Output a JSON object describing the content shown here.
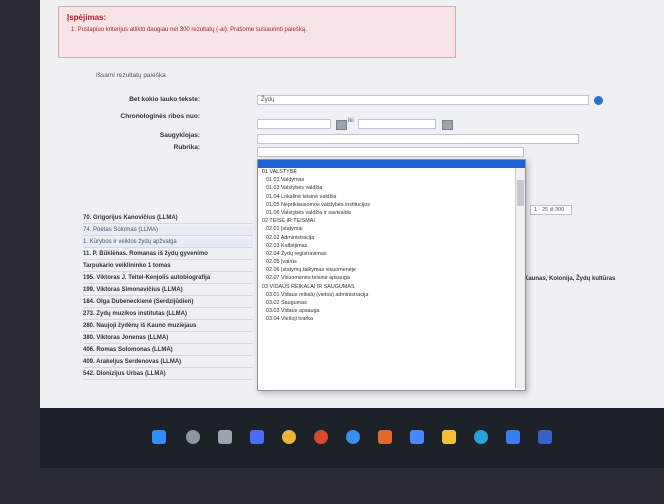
{
  "alert": {
    "title": "Įspėjimas:",
    "message": "1. Puslapiuo kriterijus atlikto daugiau nei 300 rezultatų (-ai). Prašome susiaurinti paiešką."
  },
  "form": {
    "section_title": "Išsami rezultatų paieška",
    "any_field_label": "Bet kokio lauko tekste:",
    "any_field_value": "Žydų",
    "date_label": "Chronologinės ribos nuo:",
    "date_to_label": "iki",
    "collection_label": "Saugyklojas:",
    "rubric_label": "Rubrika:"
  },
  "dropdown_options": [
    {
      "text": "01 VALSTYBĖ",
      "sub": false
    },
    {
      "text": "01.01 Valdymas",
      "sub": true
    },
    {
      "text": "01.03 Valstybės valdžia",
      "sub": true
    },
    {
      "text": "01.04 Lokalinė teisinė valdžia",
      "sub": true
    },
    {
      "text": "01.05 Nepriklausomos valstybės institucijos",
      "sub": true
    },
    {
      "text": "01.06 Valstybės valdžia ir savivalda",
      "sub": true
    },
    {
      "text": "02 TEISĖ IR TEISMAI",
      "sub": false
    },
    {
      "text": "02.01 Įstatymai",
      "sub": true
    },
    {
      "text": "02.02 Administracija",
      "sub": true
    },
    {
      "text": "02.03 Kalbėjimas",
      "sub": true
    },
    {
      "text": "02.04 Žydų registravimas",
      "sub": true
    },
    {
      "text": "02.05 Įvairūs",
      "sub": true
    },
    {
      "text": "02.06 Įstatymų taikymas visuomenėje",
      "sub": true
    },
    {
      "text": "02.07 Visuomenės teisinė apsauga",
      "sub": true
    },
    {
      "text": "03 VIDAUS REIKALAI IR SAUGUMAS",
      "sub": false
    },
    {
      "text": "03.01 Vidaus reikalų (vietos) administracija",
      "sub": true
    },
    {
      "text": "03.02 Saugumas",
      "sub": true
    },
    {
      "text": "03.03 Vidaus apsauga",
      "sub": true
    },
    {
      "text": "03.04 Viešoji tvarka",
      "sub": true
    }
  ],
  "results": [
    {
      "text": "70. Grigorijus Kanovičius (LLMA)",
      "sub": false
    },
    {
      "text": "74. Poetas Šolomas (LLMA)",
      "sub": true
    },
    {
      "text": "1. Kūrybos ir veiklos žydų apžvalga",
      "sub": true
    },
    {
      "text": "11. P. Būklėnas. Romanas iš žydų gyvenimo",
      "sub": false
    },
    {
      "text": "Tarpukario veiklininko 1 tomas",
      "sub": false
    },
    {
      "text": "195. Viktoras J. Teitel-Kenjolis autobiografija",
      "sub": false
    },
    {
      "text": "199. Viktoras Šimonavičius (LLMA)",
      "sub": false
    },
    {
      "text": "184. Olga Dubeneckienė (Šerdzijūdien)",
      "sub": false
    },
    {
      "text": "273. Žydų muzikos institutas (LLMA)",
      "sub": false
    },
    {
      "text": "280. Naujoji žydėnų iš Kauno muziejaus",
      "sub": false
    },
    {
      "text": "380. Viktoras Jonenas (LLMA)",
      "sub": false
    },
    {
      "text": "406. Romas Šolomonas (LLMA)",
      "sub": false
    },
    {
      "text": "409. Arakeljus Šerdenovas (LLMA)",
      "sub": false
    },
    {
      "text": "542. Dionizijus Urbas (LLMA)",
      "sub": false
    }
  ],
  "right_text": "Kaunas, Kolonija, Žydų kultūras",
  "pager": "1 - 25 iš 300",
  "colors": {
    "alert_text": "#b3202c",
    "selection": "#1f62d6",
    "taskbar": "#1d2229"
  }
}
